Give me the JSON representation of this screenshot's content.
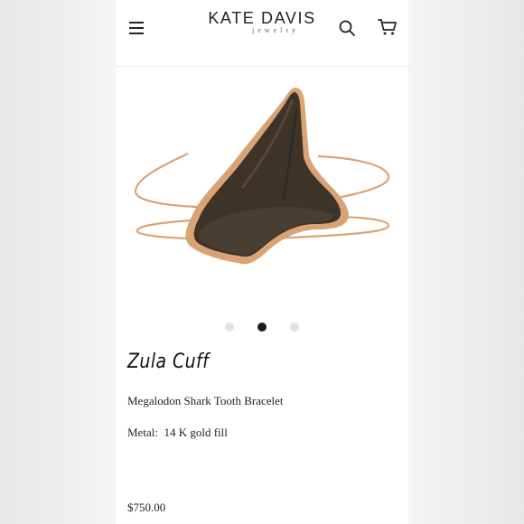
{
  "brand": {
    "name": "KATE DAVIS",
    "subline": "jewelry"
  },
  "header": {
    "menu_icon": "menu-icon",
    "search_icon": "search-icon",
    "cart_icon": "cart-icon"
  },
  "gallery": {
    "slide_count": 3,
    "active_index": 1
  },
  "product": {
    "title": "Zula Cuff",
    "subtitle": "Megalodon Shark Tooth Bracelet",
    "metal_label": "Metal:",
    "metal_value": "14 K gold fill",
    "price": "$750.00"
  },
  "colors": {
    "gold": "#d9a374",
    "tooth": "#3a3128",
    "active_dot": "#1c1c1c",
    "inactive_dot": "#e2e2e2"
  }
}
